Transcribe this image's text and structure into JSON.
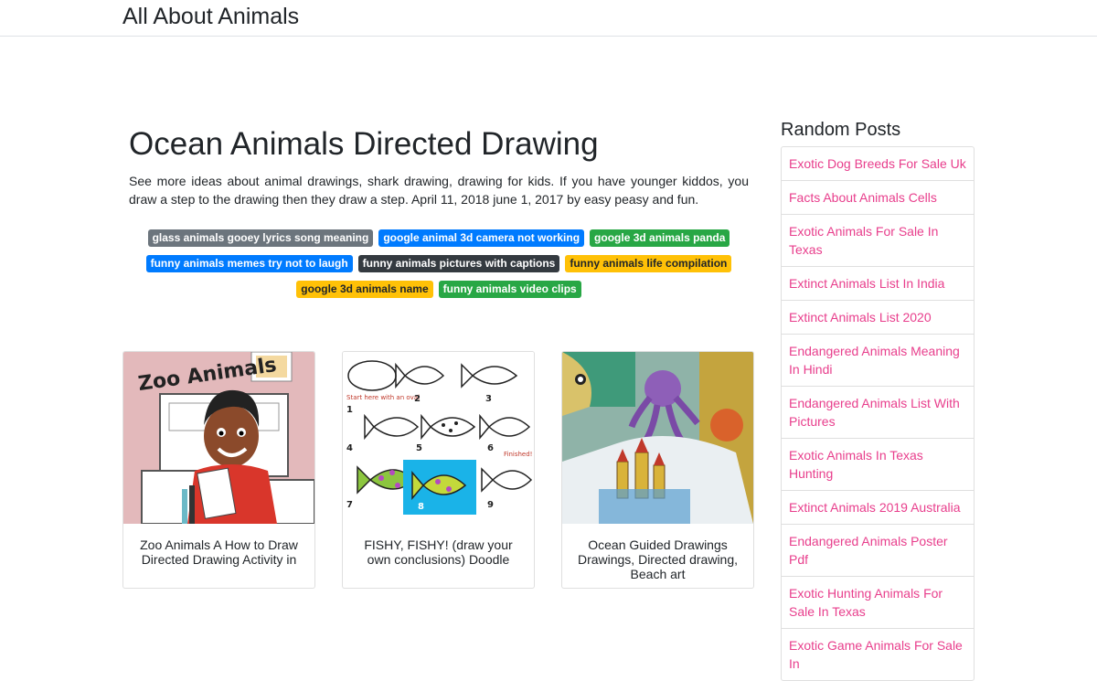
{
  "site": {
    "brand": "All About Animals"
  },
  "post": {
    "title": "Ocean Animals Directed Drawing",
    "excerpt": "See more ideas about animal drawings, shark drawing, drawing for kids. If you have younger kiddos, you draw a step to the drawing then they draw a step. April 11, 2018 june 1, 2017 by easy peasy and fun."
  },
  "tags": [
    {
      "label": "glass animals gooey lyrics song meaning",
      "color": "#6c757d",
      "dark": false
    },
    {
      "label": "google animal 3d camera not working",
      "color": "#007bff",
      "dark": false
    },
    {
      "label": "google 3d animals panda",
      "color": "#28a745",
      "dark": false
    },
    {
      "label": "funny animals memes try not to laugh",
      "color": "#007bff",
      "dark": false
    },
    {
      "label": "funny animals pictures with captions",
      "color": "#343a40",
      "dark": false
    },
    {
      "label": "funny animals life compilation",
      "color": "#ffc107",
      "dark": true
    },
    {
      "label": "google 3d animals name",
      "color": "#ffc107",
      "dark": true
    },
    {
      "label": "funny animals video clips",
      "color": "#28a745",
      "dark": false
    }
  ],
  "cards": [
    {
      "caption": "Zoo Animals A How to Draw Directed Drawing Activity in",
      "image_text": "Zoo Animals"
    },
    {
      "caption": "FISHY, FISHY! (draw your own conclusions) Doodle",
      "image_text": "Start here with an oval",
      "image_text_2": "Finished!",
      "steps": [
        "1",
        "2",
        "3",
        "4",
        "5",
        "6",
        "7",
        "8",
        "9"
      ]
    },
    {
      "caption": "Ocean Guided Drawings Drawings, Directed drawing, Beach art"
    }
  ],
  "sidebar": {
    "title": "Random Posts",
    "items": [
      "Exotic Dog Breeds For Sale Uk",
      "Facts About Animals Cells",
      "Exotic Animals For Sale In Texas",
      "Extinct Animals List In India",
      "Extinct Animals List 2020",
      "Endangered Animals Meaning In Hindi",
      "Endangered Animals List With Pictures",
      "Exotic Animals In Texas Hunting",
      "Extinct Animals 2019 Australia",
      "Endangered Animals Poster Pdf",
      "Exotic Hunting Animals For Sale In Texas",
      "Exotic Game Animals For Sale In"
    ]
  },
  "colors": {
    "link": "#e83e8c",
    "border": "#dee2e6"
  }
}
